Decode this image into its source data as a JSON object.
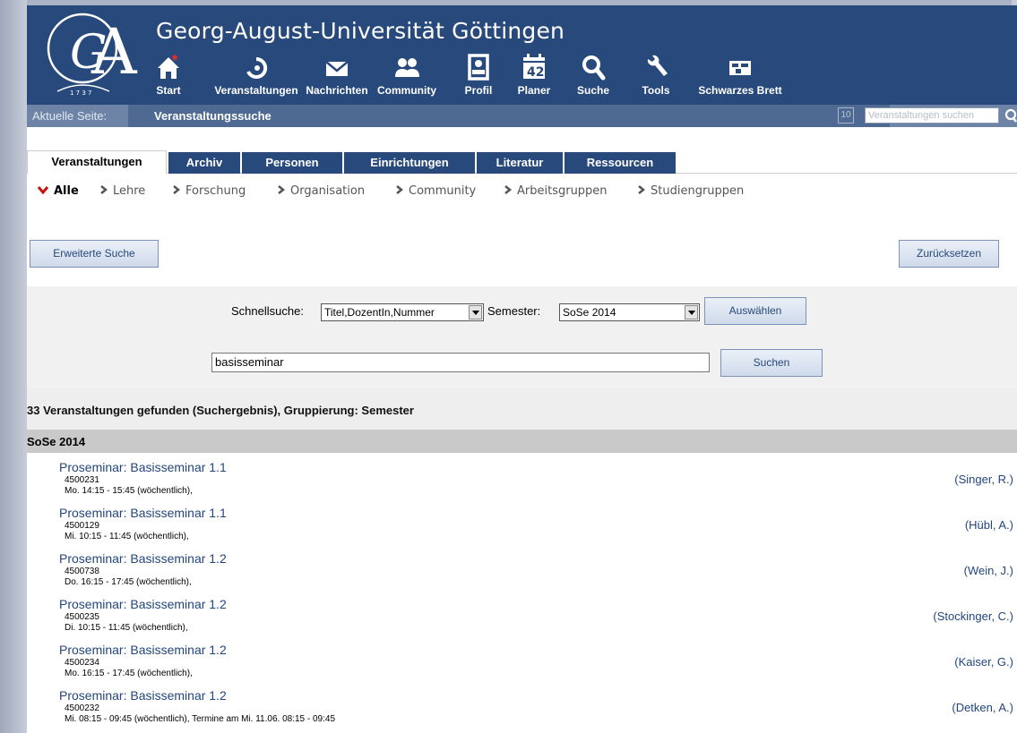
{
  "header": {
    "university": "Georg-August-Universität Göttingen",
    "nav": [
      {
        "label": "Start",
        "icon": "home-icon"
      },
      {
        "label": "Veranstaltungen",
        "icon": "seminar-icon"
      },
      {
        "label": "Nachrichten",
        "icon": "mail-icon"
      },
      {
        "label": "Community",
        "icon": "community-icon"
      },
      {
        "label": "Profil",
        "icon": "profile-icon"
      },
      {
        "label": "Planer",
        "icon": "calendar-icon",
        "badge": "42"
      },
      {
        "label": "Suche",
        "icon": "search-icon",
        "active": true
      },
      {
        "label": "Tools",
        "icon": "wrench-icon"
      },
      {
        "label": "Schwarzes Brett",
        "icon": "board-icon"
      }
    ]
  },
  "current_page": {
    "label": "Aktuelle Seite:",
    "value": "Veranstaltungssuche",
    "counter": "10",
    "search_placeholder": "Veranstaltungen suchen"
  },
  "tabs": [
    "Veranstaltungen",
    "Archiv",
    "Personen",
    "Einrichtungen",
    "Literatur",
    "Ressourcen"
  ],
  "subnav": [
    "Alle",
    "Lehre",
    "Forschung",
    "Organisation",
    "Community",
    "Arbeitsgruppen",
    "Studiengruppen"
  ],
  "buttons": {
    "advanced": "Erweiterte Suche",
    "reset": "Zurücksetzen",
    "select": "Auswählen",
    "search": "Suchen"
  },
  "search": {
    "quick_label": "Schnellsuche:",
    "quick_value": "Titel,DozentIn,Nummer",
    "semester_label": "Semester:",
    "semester_value": "SoSe 2014",
    "query": "basisseminar"
  },
  "results": {
    "summary": "33 Veranstaltungen gefunden (Suchergebnis), Gruppierung: Semester",
    "semester": "SoSe 2014",
    "items": [
      {
        "title": "Proseminar: Basisseminar 1.1",
        "number": "4500231",
        "time": "Mo. 14:15 - 15:45 (wöchentlich),",
        "lecturer": "(Singer, R.)"
      },
      {
        "title": "Proseminar: Basisseminar 1.1",
        "number": "4500129",
        "time": "Mi. 10:15 - 11:45 (wöchentlich),",
        "lecturer": "(Hübl, A.)"
      },
      {
        "title": "Proseminar: Basisseminar 1.2",
        "number": "4500738",
        "time": "Do. 16:15 - 17:45 (wöchentlich),",
        "lecturer": "(Wein, J.)"
      },
      {
        "title": "Proseminar: Basisseminar 1.2",
        "number": "4500235",
        "time": "Di. 10:15 - 11:45 (wöchentlich),",
        "lecturer": "(Stockinger, C.)"
      },
      {
        "title": "Proseminar: Basisseminar 1.2",
        "number": "4500234",
        "time": "Mo. 16:15 - 17:45 (wöchentlich),",
        "lecturer": "(Kaiser, G.)"
      },
      {
        "title": "Proseminar: Basisseminar 1.2",
        "number": "4500232",
        "time": "Mi. 08:15 - 09:45 (wöchentlich), Termine am Mi. 11.06. 08:15 - 09:45",
        "lecturer": "(Detken, A.)"
      }
    ]
  },
  "colors": {
    "header": "#28497c",
    "link": "#24467d",
    "subnav_active_chevron": "#cc1111"
  }
}
